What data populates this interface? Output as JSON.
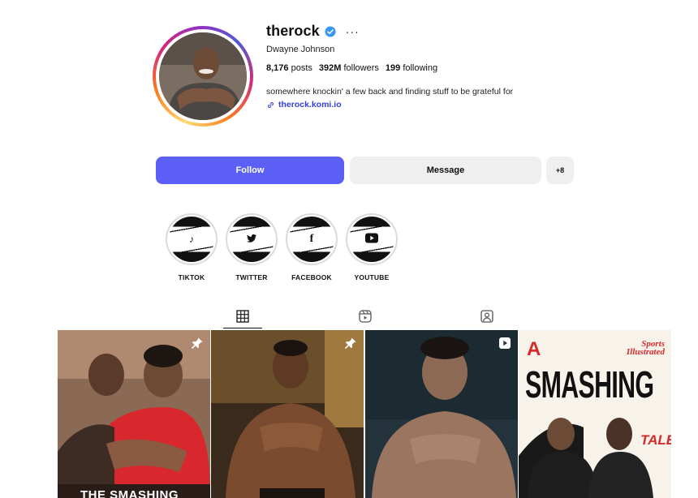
{
  "profile": {
    "username": "therock",
    "more": "···",
    "full_name": "Dwayne Johnson",
    "stats": {
      "posts_count": "8,176",
      "posts_label": "posts",
      "followers_count": "392M",
      "followers_label": "followers",
      "following_count": "199",
      "following_label": "following"
    },
    "bio": "somewhere knockin' a few back and finding stuff to be grateful for",
    "link": "therock.komi.io"
  },
  "actions": {
    "follow_label": "Follow",
    "message_label": "Message",
    "add_label": "+8"
  },
  "highlights": [
    {
      "label": "TIKTOK",
      "icon": "tiktok-icon",
      "glyph": "♪"
    },
    {
      "label": "TWITTER",
      "icon": "twitter-icon",
      "glyph": "🐦"
    },
    {
      "label": "FACEBOOK",
      "icon": "facebook-icon",
      "glyph": "f"
    },
    {
      "label": "YOUTUBE",
      "icon": "youtube-icon",
      "glyph": "▶"
    }
  ],
  "tabs": [
    {
      "name": "posts-grid",
      "icon": "grid-icon"
    },
    {
      "name": "reels",
      "icon": "reels-icon"
    },
    {
      "name": "tagged",
      "icon": "tagged-icon"
    }
  ],
  "posts": [
    {
      "badge": "pin-icon",
      "overlay_text": "THE SMASHING"
    },
    {
      "badge": "pin-icon",
      "overlay_text": ""
    },
    {
      "badge": "reel-icon",
      "overlay_text": ""
    },
    {
      "badge": "",
      "overlay_text": ""
    }
  ],
  "post4_cover": {
    "masthead": "Sports Illustrated",
    "title_a": "A",
    "title_big": "SMASHING",
    "title_tale": "TALE"
  },
  "colors": {
    "follow_button": "#5b5ff6",
    "link": "#3541d3",
    "verified": "#3897f0"
  }
}
